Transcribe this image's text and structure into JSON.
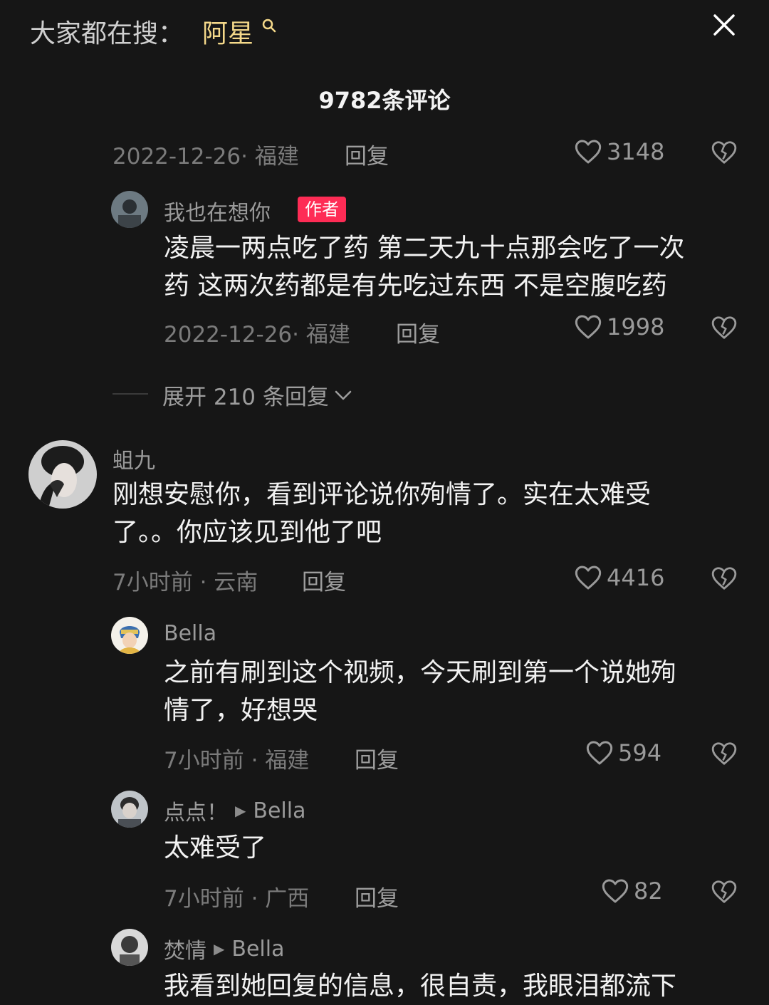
{
  "header": {
    "search_prefix": "大家都在搜：",
    "search_term": "阿星",
    "comment_count": "9782条评论"
  },
  "comments": [
    {
      "meta": "2022-12-26· 福建",
      "reply": "回复",
      "likes": "3148"
    },
    {
      "username": "我也在想你",
      "badge": "作者",
      "text_lines": [
        "凌晨一两点吃了药 第二天九十点那会吃了一次",
        "药 这两次药都是有先吃过东西 不是空腹吃药"
      ],
      "meta": "2022-12-26· 福建",
      "reply": "回复",
      "likes": "1998"
    },
    {
      "expand": "展开 210 条回复"
    },
    {
      "username": "蛆九",
      "text_lines": [
        "刚想安慰你，看到评论说你殉情了。实在太难受",
        "了。。你应该见到他了吧"
      ],
      "meta": "7小时前 · 云南",
      "reply": "回复",
      "likes": "4416"
    },
    {
      "username": "Bella",
      "text_lines": [
        "之前有刷到这个视频，今天刷到第一个说她殉",
        "情了，好想哭"
      ],
      "meta": "7小时前 · 福建",
      "reply": "回复",
      "likes": "594"
    },
    {
      "username": "点点！",
      "reply_to": "Bella",
      "text_lines": [
        "太难受了"
      ],
      "meta": "7小时前 · 广西",
      "reply": "回复",
      "likes": "82"
    },
    {
      "username": "焚情",
      "reply_to": "Bella",
      "text_lines": [
        "我看到她回复的信息，很自责，我眼泪都流下"
      ]
    }
  ],
  "icons": {
    "like": "heart-outline-icon",
    "dislike": "broken-heart-icon",
    "close": "close-icon",
    "search": "search-icon",
    "arrow": "play-arrow-icon",
    "chevron": "chevron-down-icon"
  },
  "colors": {
    "background": "#161616",
    "search_term": "#f5d98a",
    "author_badge": "#fe2c55"
  }
}
